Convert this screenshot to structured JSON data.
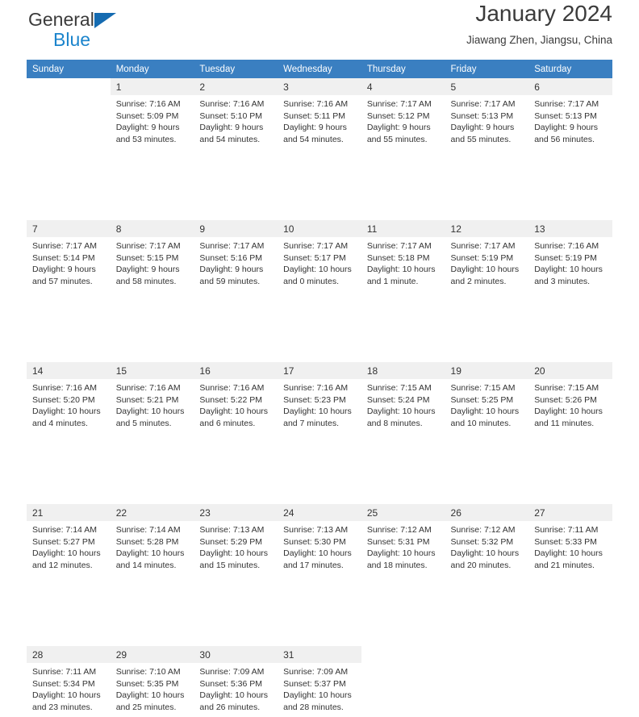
{
  "brand": {
    "name_top": "General",
    "name_bottom": "Blue",
    "triangle_color": "#156bb1",
    "blue_text_color": "#1b84cc"
  },
  "header": {
    "title": "January 2024",
    "subtitle": "Jiawang Zhen, Jiangsu, China"
  },
  "theme": {
    "header_row_bg": "#3a7fc1",
    "header_row_text": "#ffffff",
    "daynum_bg": "#f0f0f0",
    "body_text": "#333333"
  },
  "weekdays": [
    "Sunday",
    "Monday",
    "Tuesday",
    "Wednesday",
    "Thursday",
    "Friday",
    "Saturday"
  ],
  "weeks": [
    [
      {
        "day": "",
        "lines": []
      },
      {
        "day": "1",
        "lines": [
          "Sunrise: 7:16 AM",
          "Sunset: 5:09 PM",
          "Daylight: 9 hours",
          "and 53 minutes."
        ]
      },
      {
        "day": "2",
        "lines": [
          "Sunrise: 7:16 AM",
          "Sunset: 5:10 PM",
          "Daylight: 9 hours",
          "and 54 minutes."
        ]
      },
      {
        "day": "3",
        "lines": [
          "Sunrise: 7:16 AM",
          "Sunset: 5:11 PM",
          "Daylight: 9 hours",
          "and 54 minutes."
        ]
      },
      {
        "day": "4",
        "lines": [
          "Sunrise: 7:17 AM",
          "Sunset: 5:12 PM",
          "Daylight: 9 hours",
          "and 55 minutes."
        ]
      },
      {
        "day": "5",
        "lines": [
          "Sunrise: 7:17 AM",
          "Sunset: 5:13 PM",
          "Daylight: 9 hours",
          "and 55 minutes."
        ]
      },
      {
        "day": "6",
        "lines": [
          "Sunrise: 7:17 AM",
          "Sunset: 5:13 PM",
          "Daylight: 9 hours",
          "and 56 minutes."
        ]
      }
    ],
    [
      {
        "day": "7",
        "lines": [
          "Sunrise: 7:17 AM",
          "Sunset: 5:14 PM",
          "Daylight: 9 hours",
          "and 57 minutes."
        ]
      },
      {
        "day": "8",
        "lines": [
          "Sunrise: 7:17 AM",
          "Sunset: 5:15 PM",
          "Daylight: 9 hours",
          "and 58 minutes."
        ]
      },
      {
        "day": "9",
        "lines": [
          "Sunrise: 7:17 AM",
          "Sunset: 5:16 PM",
          "Daylight: 9 hours",
          "and 59 minutes."
        ]
      },
      {
        "day": "10",
        "lines": [
          "Sunrise: 7:17 AM",
          "Sunset: 5:17 PM",
          "Daylight: 10 hours",
          "and 0 minutes."
        ]
      },
      {
        "day": "11",
        "lines": [
          "Sunrise: 7:17 AM",
          "Sunset: 5:18 PM",
          "Daylight: 10 hours",
          "and 1 minute."
        ]
      },
      {
        "day": "12",
        "lines": [
          "Sunrise: 7:17 AM",
          "Sunset: 5:19 PM",
          "Daylight: 10 hours",
          "and 2 minutes."
        ]
      },
      {
        "day": "13",
        "lines": [
          "Sunrise: 7:16 AM",
          "Sunset: 5:19 PM",
          "Daylight: 10 hours",
          "and 3 minutes."
        ]
      }
    ],
    [
      {
        "day": "14",
        "lines": [
          "Sunrise: 7:16 AM",
          "Sunset: 5:20 PM",
          "Daylight: 10 hours",
          "and 4 minutes."
        ]
      },
      {
        "day": "15",
        "lines": [
          "Sunrise: 7:16 AM",
          "Sunset: 5:21 PM",
          "Daylight: 10 hours",
          "and 5 minutes."
        ]
      },
      {
        "day": "16",
        "lines": [
          "Sunrise: 7:16 AM",
          "Sunset: 5:22 PM",
          "Daylight: 10 hours",
          "and 6 minutes."
        ]
      },
      {
        "day": "17",
        "lines": [
          "Sunrise: 7:16 AM",
          "Sunset: 5:23 PM",
          "Daylight: 10 hours",
          "and 7 minutes."
        ]
      },
      {
        "day": "18",
        "lines": [
          "Sunrise: 7:15 AM",
          "Sunset: 5:24 PM",
          "Daylight: 10 hours",
          "and 8 minutes."
        ]
      },
      {
        "day": "19",
        "lines": [
          "Sunrise: 7:15 AM",
          "Sunset: 5:25 PM",
          "Daylight: 10 hours",
          "and 10 minutes."
        ]
      },
      {
        "day": "20",
        "lines": [
          "Sunrise: 7:15 AM",
          "Sunset: 5:26 PM",
          "Daylight: 10 hours",
          "and 11 minutes."
        ]
      }
    ],
    [
      {
        "day": "21",
        "lines": [
          "Sunrise: 7:14 AM",
          "Sunset: 5:27 PM",
          "Daylight: 10 hours",
          "and 12 minutes."
        ]
      },
      {
        "day": "22",
        "lines": [
          "Sunrise: 7:14 AM",
          "Sunset: 5:28 PM",
          "Daylight: 10 hours",
          "and 14 minutes."
        ]
      },
      {
        "day": "23",
        "lines": [
          "Sunrise: 7:13 AM",
          "Sunset: 5:29 PM",
          "Daylight: 10 hours",
          "and 15 minutes."
        ]
      },
      {
        "day": "24",
        "lines": [
          "Sunrise: 7:13 AM",
          "Sunset: 5:30 PM",
          "Daylight: 10 hours",
          "and 17 minutes."
        ]
      },
      {
        "day": "25",
        "lines": [
          "Sunrise: 7:12 AM",
          "Sunset: 5:31 PM",
          "Daylight: 10 hours",
          "and 18 minutes."
        ]
      },
      {
        "day": "26",
        "lines": [
          "Sunrise: 7:12 AM",
          "Sunset: 5:32 PM",
          "Daylight: 10 hours",
          "and 20 minutes."
        ]
      },
      {
        "day": "27",
        "lines": [
          "Sunrise: 7:11 AM",
          "Sunset: 5:33 PM",
          "Daylight: 10 hours",
          "and 21 minutes."
        ]
      }
    ],
    [
      {
        "day": "28",
        "lines": [
          "Sunrise: 7:11 AM",
          "Sunset: 5:34 PM",
          "Daylight: 10 hours",
          "and 23 minutes."
        ]
      },
      {
        "day": "29",
        "lines": [
          "Sunrise: 7:10 AM",
          "Sunset: 5:35 PM",
          "Daylight: 10 hours",
          "and 25 minutes."
        ]
      },
      {
        "day": "30",
        "lines": [
          "Sunrise: 7:09 AM",
          "Sunset: 5:36 PM",
          "Daylight: 10 hours",
          "and 26 minutes."
        ]
      },
      {
        "day": "31",
        "lines": [
          "Sunrise: 7:09 AM",
          "Sunset: 5:37 PM",
          "Daylight: 10 hours",
          "and 28 minutes."
        ]
      },
      {
        "day": "",
        "lines": []
      },
      {
        "day": "",
        "lines": []
      },
      {
        "day": "",
        "lines": []
      }
    ]
  ]
}
